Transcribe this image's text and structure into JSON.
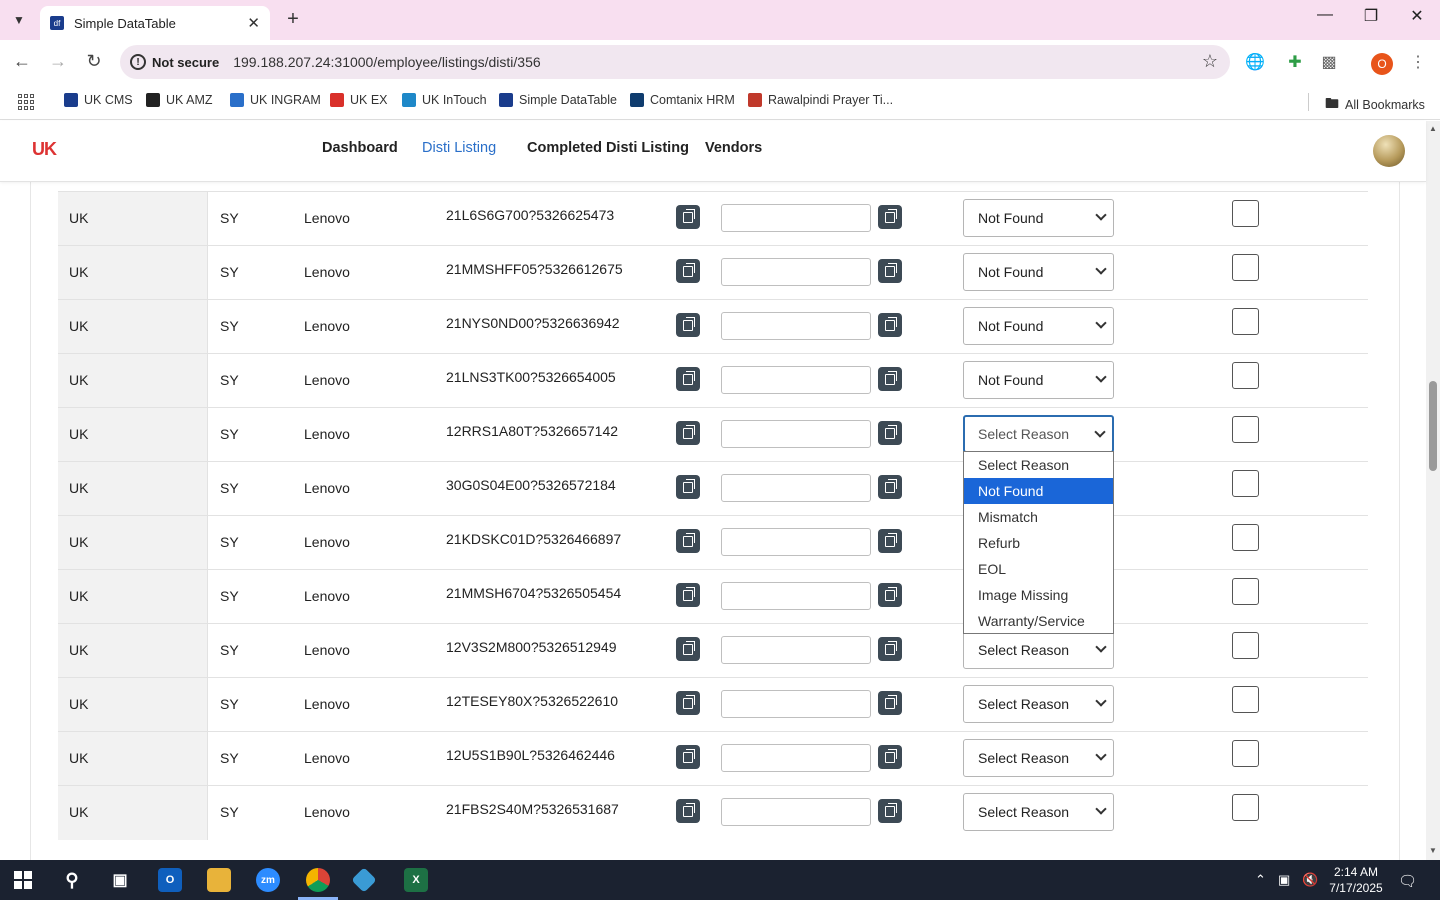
{
  "browser": {
    "tab_title": "Simple DataTable",
    "favicon_text": "df",
    "security_label": "Not secure",
    "url": "199.188.207.24:31000/employee/listings/disti/356",
    "profile_initial": "O",
    "bookmarks": [
      {
        "label": "UK CMS",
        "color": "#1a3c8c"
      },
      {
        "label": "UK AMZ",
        "color": "#222222"
      },
      {
        "label": "UK INGRAM",
        "color": "#2a6fc9"
      },
      {
        "label": "UK EX",
        "color": "#d9302a"
      },
      {
        "label": "UK InTouch",
        "color": "#1e88c8"
      },
      {
        "label": "Simple DataTable",
        "color": "#1a3c8c"
      },
      {
        "label": "Comtanix HRM",
        "color": "#0f3c6e"
      },
      {
        "label": "Rawalpindi Prayer Ti...",
        "color": "#c0392b"
      }
    ],
    "all_bookmarks": "All Bookmarks"
  },
  "app": {
    "logo": "UK",
    "nav": [
      {
        "label": "Dashboard",
        "active": false
      },
      {
        "label": "Disti Listing",
        "active": true
      },
      {
        "label": "Completed Disti Listing",
        "active": false
      },
      {
        "label": "Vendors",
        "active": false
      }
    ]
  },
  "table": {
    "rows": [
      {
        "country": "UK",
        "code": "SY",
        "brand": "Lenovo",
        "sku": "21L6S6G700?5326625473",
        "reason": "Not Found"
      },
      {
        "country": "UK",
        "code": "SY",
        "brand": "Lenovo",
        "sku": "21MMSHFF05?5326612675",
        "reason": "Not Found"
      },
      {
        "country": "UK",
        "code": "SY",
        "brand": "Lenovo",
        "sku": "21NYS0ND00?5326636942",
        "reason": "Not Found"
      },
      {
        "country": "UK",
        "code": "SY",
        "brand": "Lenovo",
        "sku": "21LNS3TK00?5326654005",
        "reason": "Not Found"
      },
      {
        "country": "UK",
        "code": "SY",
        "brand": "Lenovo",
        "sku": "12RRS1A80T?5326657142",
        "reason": "Select Reason"
      },
      {
        "country": "UK",
        "code": "SY",
        "brand": "Lenovo",
        "sku": "30G0S04E00?5326572184",
        "reason": ""
      },
      {
        "country": "UK",
        "code": "SY",
        "brand": "Lenovo",
        "sku": "21KDSKC01D?5326466897",
        "reason": ""
      },
      {
        "country": "UK",
        "code": "SY",
        "brand": "Lenovo",
        "sku": "21MMSH6704?5326505454",
        "reason": ""
      },
      {
        "country": "UK",
        "code": "SY",
        "brand": "Lenovo",
        "sku": "12V3S2M800?5326512949",
        "reason": "Select Reason"
      },
      {
        "country": "UK",
        "code": "SY",
        "brand": "Lenovo",
        "sku": "12TESEY80X?5326522610",
        "reason": "Select Reason"
      },
      {
        "country": "UK",
        "code": "SY",
        "brand": "Lenovo",
        "sku": "12U5S1B90L?5326462446",
        "reason": "Select Reason"
      },
      {
        "country": "UK",
        "code": "SY",
        "brand": "Lenovo",
        "sku": "21FBS2S40M?5326531687",
        "reason": "Select Reason"
      }
    ],
    "reason_options": [
      "Select Reason",
      "Not Found",
      "Mismatch",
      "Refurb",
      "EOL",
      "Image Missing",
      "Warranty/Service"
    ],
    "highlighted_option": "Not Found"
  },
  "taskbar": {
    "time": "2:14 AM",
    "date": "7/17/2025"
  }
}
